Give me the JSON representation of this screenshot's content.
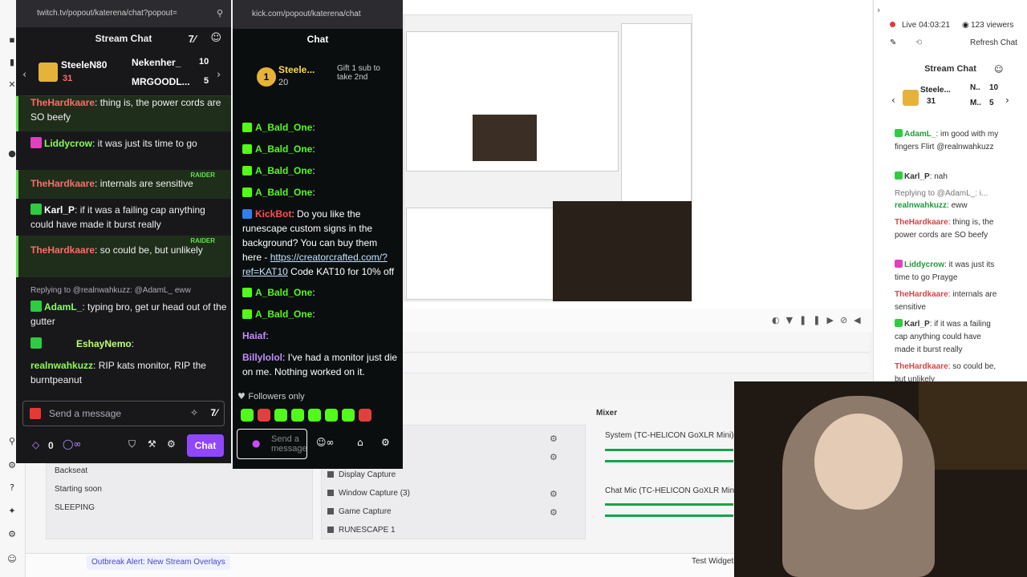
{
  "twitch": {
    "url": "twitch.tv/popout/katerena/chat?popout=",
    "title": "Stream Chat",
    "gift": {
      "top_name": "SteeleN80",
      "top_count": "31",
      "second_name": "Nekenher_",
      "second_count": "10",
      "third_name": "MRGOODL...",
      "third_count": "5"
    },
    "messages": [
      {
        "user": "TheHardkaare",
        "text": ": thing is, the power cords are SO beefy"
      },
      {
        "user": "Liddycrow",
        "text": ": it was just its time to go"
      },
      {
        "user": "TheHardkaare",
        "text": ": internals are sensitive"
      },
      {
        "user": "Karl_P",
        "text": ": if it was a failing cap anything could have made it burst really"
      },
      {
        "user": "TheHardkaare",
        "text": ": so could be, but unlikely"
      },
      {
        "user": "AdamL_",
        "text": ": typing bro, get ur head out of the gutter"
      },
      {
        "user": "EshayNemo",
        "text": ":"
      },
      {
        "user": "realnwahkuzz",
        "text": ": RIP kats monitor, RIP the burntpeanut"
      }
    ],
    "raider": "RAIDER",
    "replying": "Replying to @realnwahkuzz: @AdamL_ eww",
    "input_placeholder": "Send a message",
    "points": "0",
    "chat_button": "Chat"
  },
  "kick": {
    "url": "kick.com/popout/katerena/chat",
    "title": "Chat",
    "top_name": "Steele...",
    "top_count": "20",
    "gift_text": "Gift 1 sub to take 2nd",
    "messages": [
      {
        "user": "A_Bald_One",
        "text": ":"
      },
      {
        "user": "A_Bald_One",
        "text": ":"
      },
      {
        "user": "A_Bald_One",
        "text": ":"
      },
      {
        "user": "A_Bald_One",
        "text": ":"
      },
      {
        "user": "KickBot",
        "text": ": Do you like the runescape custom signs in the background? You can buy them here - ",
        "link": "https://creatorcrafted.com/?ref=KAT10",
        "after": " Code KAT10 for 10% off"
      },
      {
        "user": "A_Bald_One",
        "text": ":"
      },
      {
        "user": "A_Bald_One",
        "text": ":"
      },
      {
        "user": "Haiaf",
        "text": ":"
      },
      {
        "user": "Billylolol",
        "text": ": I've had a monitor just die on me. Nothing worked on it."
      }
    ],
    "followers_only": "Followers only",
    "input_placeholder": "Send a message"
  },
  "right": {
    "live": "Live 04:03:21",
    "viewers": "123 viewers",
    "refresh": "Refresh Chat",
    "title": "Stream Chat",
    "gift_name": "Steele...",
    "gift_count": "31",
    "n_name": "N..",
    "n_count": "10",
    "m_name": "M..",
    "m_count": "5",
    "messages": [
      {
        "user": "AdamL_",
        "text": ": im good with my fingers Flirt @realnwahkuzz"
      },
      {
        "user": "Karl_P",
        "text": ": nah"
      },
      {
        "user": "",
        "text": "Replying to @AdamL_: i..."
      },
      {
        "user": "realnwahkuzz",
        "text": ": eww"
      },
      {
        "user": "TheHardkaare",
        "text": ": thing is, the power cords are SO beefy"
      },
      {
        "user": "Liddycrow",
        "text": ": it was just its time to go Prayge"
      },
      {
        "user": "TheHardkaare",
        "text": ": internals are sensitive"
      },
      {
        "user": "Karl_P",
        "text": ": if it was a failing cap anything could have made it burst really"
      },
      {
        "user": "TheHardkaare",
        "text": ": so could be, but unlikely"
      }
    ]
  },
  "obs": {
    "scenes": [
      "Backseat",
      "Starting soon",
      "SLEEPING"
    ],
    "sources": [
      "Display Capture",
      "Window Capture (3)",
      "Game Capture",
      "RUNESCAPE 1"
    ],
    "mixer_title": "Mixer",
    "mixer_channels": [
      "System (TC-HELICON GoXLR Mini)",
      "Chat Mic (TC-HELICON GoXLR Mini)"
    ],
    "outbreak": "Outbreak Alert: New Stream Overlays",
    "test_widgets": "Test Widgets"
  },
  "colors": {
    "twitch_purple": "#9147ff",
    "kick_green": "#53fc18",
    "raider_green": "#5ee14a"
  }
}
